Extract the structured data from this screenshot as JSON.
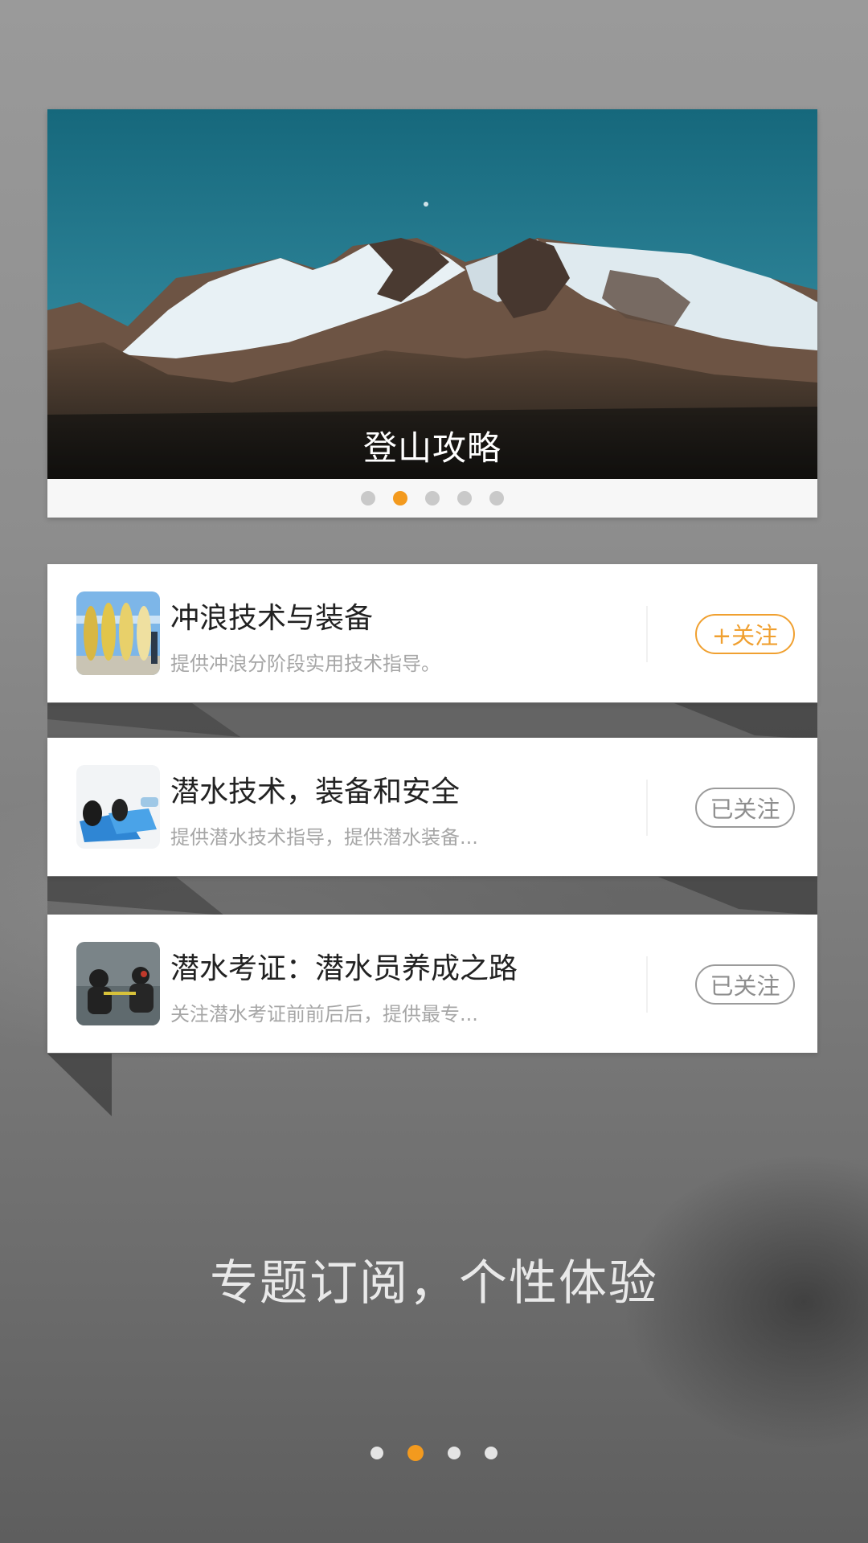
{
  "banner": {
    "caption": "登山攻略",
    "dot_count": 5,
    "active_dot": 1
  },
  "topics": [
    {
      "title": "冲浪技术与装备",
      "description": "提供冲浪分阶段实用技术指导。",
      "follow_label": "+关注",
      "followed": false
    },
    {
      "title": "潜水技术，装备和安全",
      "description": "提供潜水技术指导，提供潜水装备...",
      "follow_label": "已关注",
      "followed": true
    },
    {
      "title": "潜水考证：潜水员养成之路",
      "description": "关注潜水考证前前后后，提供最专...",
      "follow_label": "已关注",
      "followed": true
    }
  ],
  "headline": "专题订阅，个性体验",
  "pager": {
    "count": 4,
    "active": 1
  },
  "colors": {
    "accent": "#f39a1e"
  }
}
